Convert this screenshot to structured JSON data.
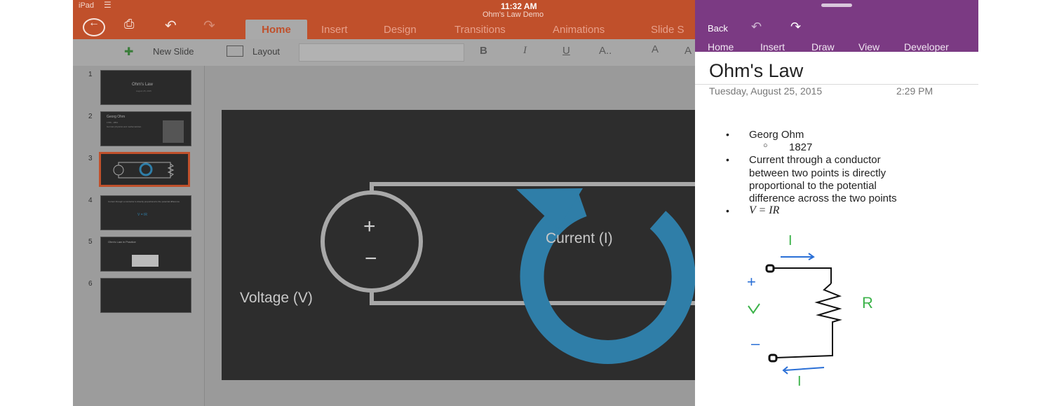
{
  "status_bar": {
    "device": "iPad",
    "time": "11:32 AM",
    "doc_title": "Ohm's Law Demo"
  },
  "ppt": {
    "tabs": [
      "Home",
      "Insert",
      "Design",
      "Transitions",
      "Animations",
      "Slide S"
    ],
    "ribbon": {
      "new_slide": "New Slide",
      "layout": "Layout",
      "bold": "B",
      "italic": "I",
      "underline": "U",
      "font_color": "A..",
      "font_a1": "A",
      "font_a2": "A"
    },
    "slide_numbers": [
      "1",
      "2",
      "3",
      "4",
      "5",
      "6"
    ],
    "thumbs": {
      "t1_title": "Ohm's Law",
      "t1_sub": "August 25, 2015",
      "t2_title": "Georg Ohm",
      "t2_line1": "1789 - 1854",
      "t2_line2": "German physicist and mathematician",
      "t4_line": "Current through a conductor is directly proportional to the potential difference",
      "t4_eq": "V = IR",
      "t5_title": "Ohm's Law in Practice"
    },
    "slide": {
      "current_label": "Current (I)",
      "voltage_label": "Voltage (V)",
      "plus": "+",
      "minus": "−"
    },
    "colors": {
      "accent": "#c0502b",
      "current_arrow": "#2f7ea8"
    }
  },
  "onenote": {
    "back": "Back",
    "menu": [
      "Home",
      "Insert",
      "Draw",
      "View",
      "Developer"
    ],
    "title": "Ohm's Law",
    "date": "Tuesday, August 25, 2015",
    "time": "2:29 PM",
    "bullets": {
      "b1": "Georg Ohm",
      "b1_sub": "1827",
      "b2_l1": "Current through a conductor",
      "b2_l2": "between two points is directly",
      "b2_l3": "proportional to the potential",
      "b2_l4": "difference across the two points",
      "b3": "V = IR"
    },
    "ink": {
      "i_top": "I",
      "i_bottom": "I",
      "plus": "+",
      "v": "V",
      "minus": "–",
      "r": "R"
    },
    "colors": {
      "accent": "#7b3a83",
      "ink_green": "#3cb34a",
      "ink_blue": "#2a6fd6"
    }
  }
}
